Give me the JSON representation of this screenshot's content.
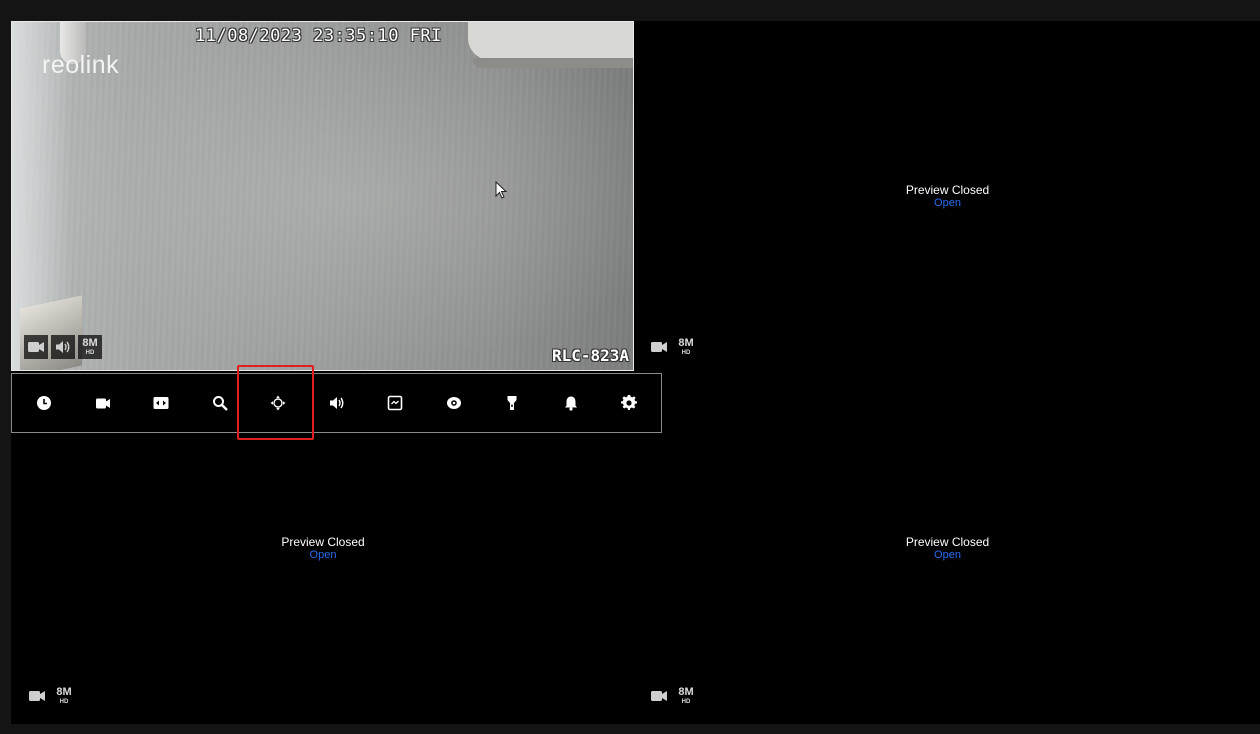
{
  "live_view": {
    "timestamp": "11/08/2023 23:35:10 FRI",
    "logo": "reolink",
    "camera_model": "RLC-823A"
  },
  "badges": {
    "resolution": "8M",
    "quality": "HD",
    "icons": [
      "video-camera-icon",
      "speaker-icon"
    ]
  },
  "panes": [
    {
      "id": 2,
      "status": "Preview Closed",
      "action": "Open"
    },
    {
      "id": 3,
      "status": "Preview Closed",
      "action": "Open"
    },
    {
      "id": 4,
      "status": "Preview Closed",
      "action": "Open"
    }
  ],
  "toolbar": {
    "buttons": [
      {
        "icon": "clock-icon"
      },
      {
        "icon": "record-icon"
      },
      {
        "icon": "fit-screen-icon"
      },
      {
        "icon": "zoom-icon"
      },
      {
        "icon": "ptz-icon",
        "highlighted": true
      },
      {
        "icon": "audio-icon"
      },
      {
        "icon": "snapshot-icon"
      },
      {
        "icon": "eye-icon"
      },
      {
        "icon": "spotlight-icon"
      },
      {
        "icon": "alarm-bell-icon"
      },
      {
        "icon": "settings-gear-icon"
      }
    ],
    "highlight_color": "#e02020"
  },
  "colors": {
    "open_link": "#2a6cf0",
    "background": "#000000",
    "frame": "#141414"
  }
}
